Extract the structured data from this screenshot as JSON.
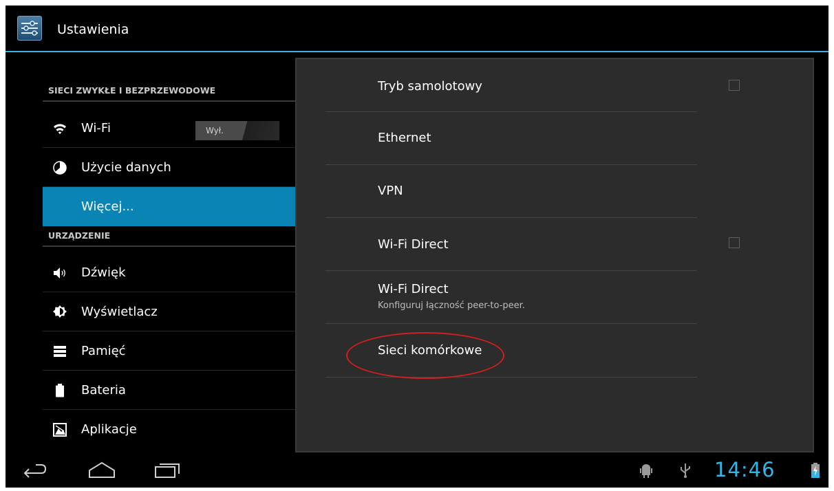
{
  "actionbar": {
    "title": "Ustawienia",
    "icon": "settings-sliders-icon"
  },
  "sidebar": {
    "section1": "SIECI ZWYKŁE I BEZPRZEWODOWE",
    "section2": "URZĄDZENIE",
    "items": [
      {
        "label": "Wi-Fi",
        "icon": "wifi-icon",
        "toggle": "Wył."
      },
      {
        "label": "Użycie danych",
        "icon": "data-usage-icon"
      },
      {
        "label": "Więcej...",
        "icon": "",
        "selected": true
      },
      {
        "label": "Dźwięk",
        "icon": "speaker-icon"
      },
      {
        "label": "Wyświetlacz",
        "icon": "brightness-icon"
      },
      {
        "label": "Pamięć",
        "icon": "storage-icon"
      },
      {
        "label": "Bateria",
        "icon": "battery-icon"
      },
      {
        "label": "Aplikacje",
        "icon": "apps-icon"
      }
    ]
  },
  "details": {
    "items": [
      {
        "title": "Tryb samolotowy",
        "checkbox": true,
        "checked": false
      },
      {
        "title": "Ethernet"
      },
      {
        "title": "VPN"
      },
      {
        "title": "Wi-Fi Direct",
        "checkbox": true,
        "checked": false
      },
      {
        "title": "Wi-Fi Direct",
        "subtitle": "Konfiguruj łączność peer-to-peer."
      },
      {
        "title": "Sieci komórkowe",
        "highlighted": true
      }
    ]
  },
  "navbar": {
    "back": "back-icon",
    "home": "home-icon",
    "recents": "recent-apps-icon",
    "time": "14:46"
  },
  "colors": {
    "accent": "#33b5e5",
    "selected": "#0a83b5",
    "highlight": "#d11f1f"
  }
}
